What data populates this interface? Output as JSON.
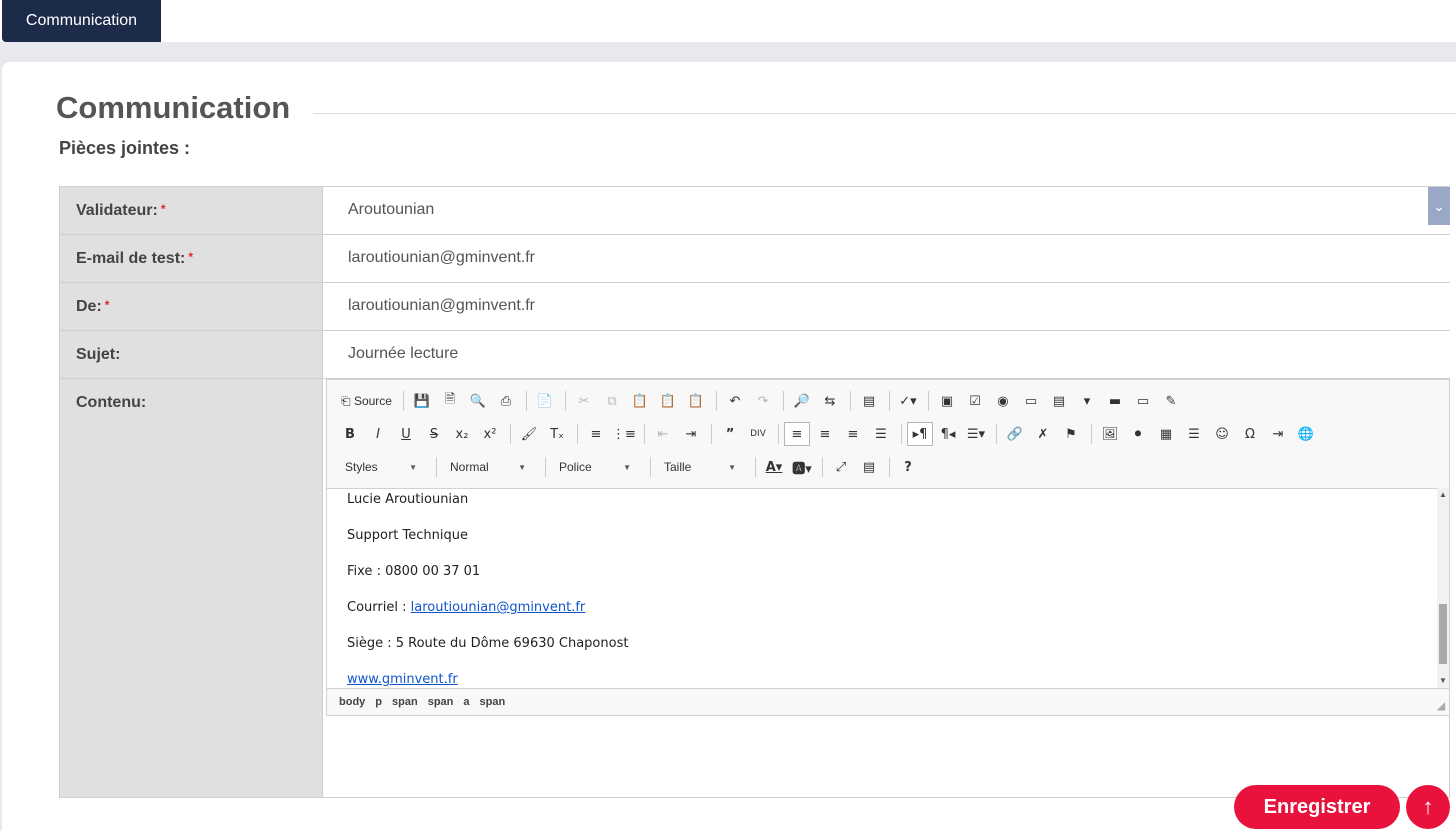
{
  "nav": {
    "active_tab": "Communication"
  },
  "section": {
    "title": "Communication",
    "attachments_label": "Pièces jointes :"
  },
  "form": {
    "rows": [
      {
        "label": "Validateur:",
        "required": "*",
        "value": "Aroutounian"
      },
      {
        "label": "E-mail de test:",
        "required": "*",
        "value": "laroutiounian@gminvent.fr"
      },
      {
        "label": "De:",
        "required": "*",
        "value": "laroutiounian@gminvent.fr"
      },
      {
        "label": "Sujet:",
        "value": "Journée lecture"
      },
      {
        "label": "Contenu:"
      }
    ]
  },
  "editor": {
    "toolbar": {
      "source_label": "Source",
      "styles": "Styles",
      "format": "Normal",
      "font": "Police",
      "size": "Taille"
    },
    "content": {
      "name": "Lucie Aroutiounian",
      "role": "Support Technique",
      "phone": "Fixe : 0800 00 37 01",
      "email_prefix": "Courriel : ",
      "email_link": "laroutiounian@gminvent.fr",
      "address": "Siège : 5  Route du Dôme 69630 Chaponost",
      "website": "www.gminvent.fr"
    },
    "path": [
      "body",
      "p",
      "span",
      "span",
      "a",
      "span"
    ]
  },
  "actions": {
    "save_label": "Enregistrer"
  },
  "colors": {
    "accent": "#e8123c",
    "nav": "#1c2b4a"
  }
}
